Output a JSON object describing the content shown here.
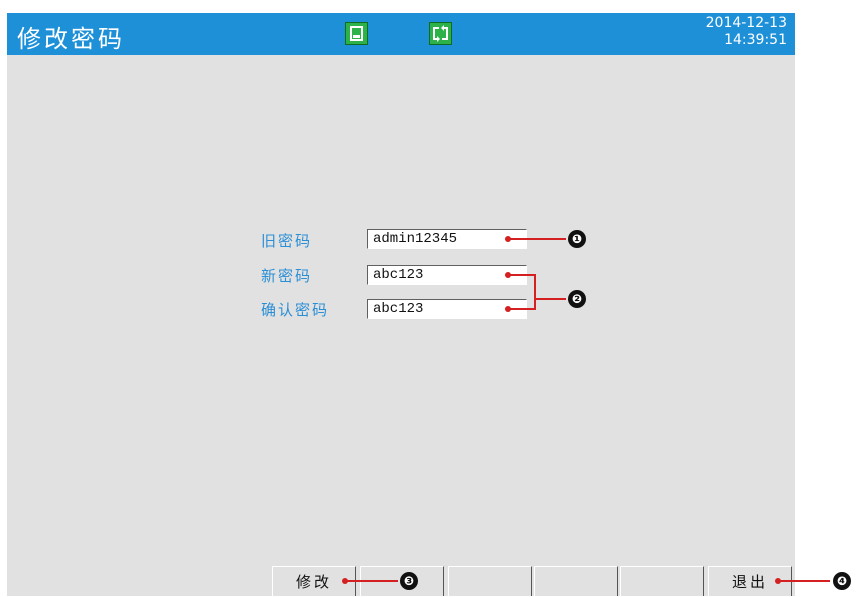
{
  "header": {
    "title": "修改密码",
    "date": "2014-12-13",
    "time": "14:39:51",
    "save_icon": "save-icon",
    "sync_icon": "sync-icon",
    "bar_color": "#1e90d8"
  },
  "form": {
    "old_password_label": "旧密码",
    "old_password_value": "admin12345",
    "new_password_label": "新密码",
    "new_password_value": "abc123",
    "confirm_password_label": "确认密码",
    "confirm_password_value": "abc123",
    "label_color": "#2b8fd6"
  },
  "softkeys": {
    "modify_label": "修改",
    "key2_label": "",
    "key3_label": "",
    "key4_label": "",
    "key5_label": "",
    "exit_label": "退出"
  },
  "callouts": {
    "c1": "❶",
    "c2": "❷",
    "c3": "❸",
    "c4": "❹",
    "color": "#d42020"
  }
}
